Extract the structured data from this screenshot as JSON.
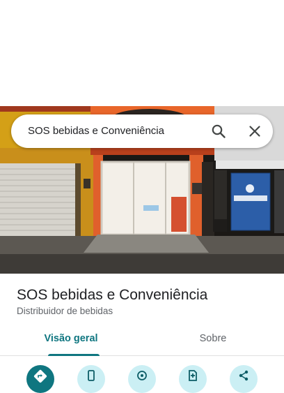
{
  "search": {
    "query": "SOS bebidas e Conveniência"
  },
  "place": {
    "name": "SOS bebidas e Conveniência",
    "category": "Distribuidor de bebidas"
  },
  "tabs": [
    {
      "label": "Visão geral",
      "active": true
    },
    {
      "label": "Sobre",
      "active": false
    }
  ],
  "actions": [
    {
      "icon": "directions-icon"
    },
    {
      "icon": "phone-icon"
    },
    {
      "icon": "location-icon"
    },
    {
      "icon": "save-icon"
    },
    {
      "icon": "share-icon"
    }
  ],
  "colors": {
    "accent": "#0f7680",
    "action_bg": "#cbeff4",
    "text_primary": "#202124",
    "text_secondary": "#5f6368"
  }
}
